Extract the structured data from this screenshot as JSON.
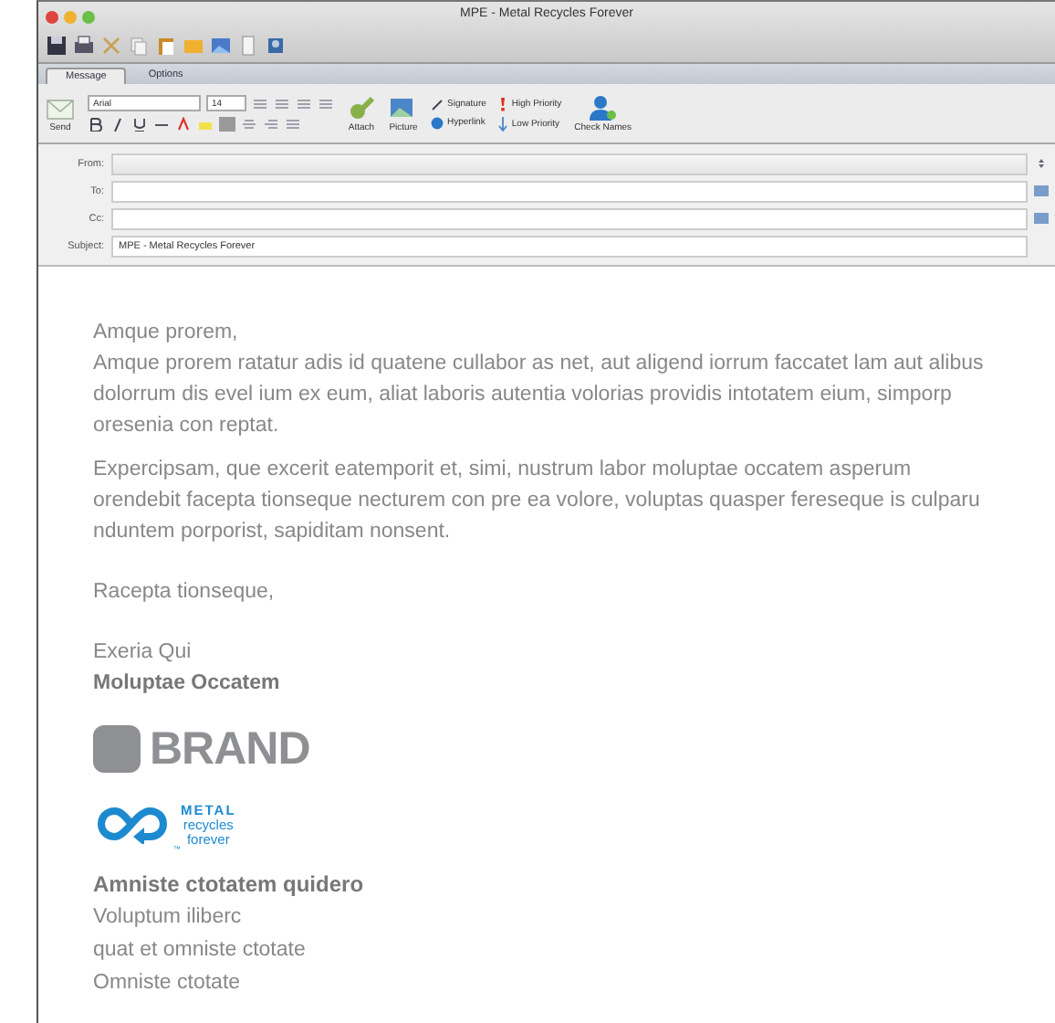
{
  "window": {
    "title": "MPE - Metal Recycles Forever"
  },
  "tabs": [
    {
      "label": "Message",
      "selected": true
    },
    {
      "label": "Options",
      "selected": false
    }
  ],
  "ribbon": {
    "send": "Send",
    "font": "Arial",
    "size": "14",
    "attach": "Attach",
    "picture": "Picture",
    "signature": "Signature",
    "hyperlink": "Hyperlink",
    "high_priority": "High Priority",
    "low_priority": "Low Priority",
    "check_names": "Check Names"
  },
  "fields": [
    {
      "label": "From:",
      "kind": "dropdown"
    },
    {
      "label": "To:",
      "kind": "address"
    },
    {
      "label": "Cc:",
      "kind": "address"
    },
    {
      "label": "Subject:",
      "kind": "text",
      "value": "MPE - Metal Recycles Forever"
    }
  ],
  "body": {
    "greeting": "Amque prorem,",
    "paragraphs": [
      "Amque prorem ratatur adis id quatene cullabor as net, aut aligend iorrum faccatet lam aut alibus dolorrum dis evel ium ex eum, aliat laboris autentia volorias providis intotatem eium, simporp oresenia con reptat.",
      "Expercipsam, que excerit eatemporit et, simi, nustrum labor moluptae occatem asperum orendebit facepta tionseque necturem con pre ea volore, voluptas quasper fereseque is culparu nduntem porporist, sapiditam nonsent."
    ],
    "closing": "Racepta tionseque,",
    "sender": {
      "name": "Exeria Qui",
      "company": "Moluptae Occatem"
    },
    "brand": "BRAND",
    "logo": {
      "lines": [
        "METAL",
        "recycles",
        "forever"
      ],
      "mark": "™"
    },
    "contact": {
      "heading": "Amniste ctotatem quidero",
      "lines": [
        "Voluptum iliberc",
        "quat et omniste ctotate",
        "Omniste ctotate"
      ]
    }
  }
}
